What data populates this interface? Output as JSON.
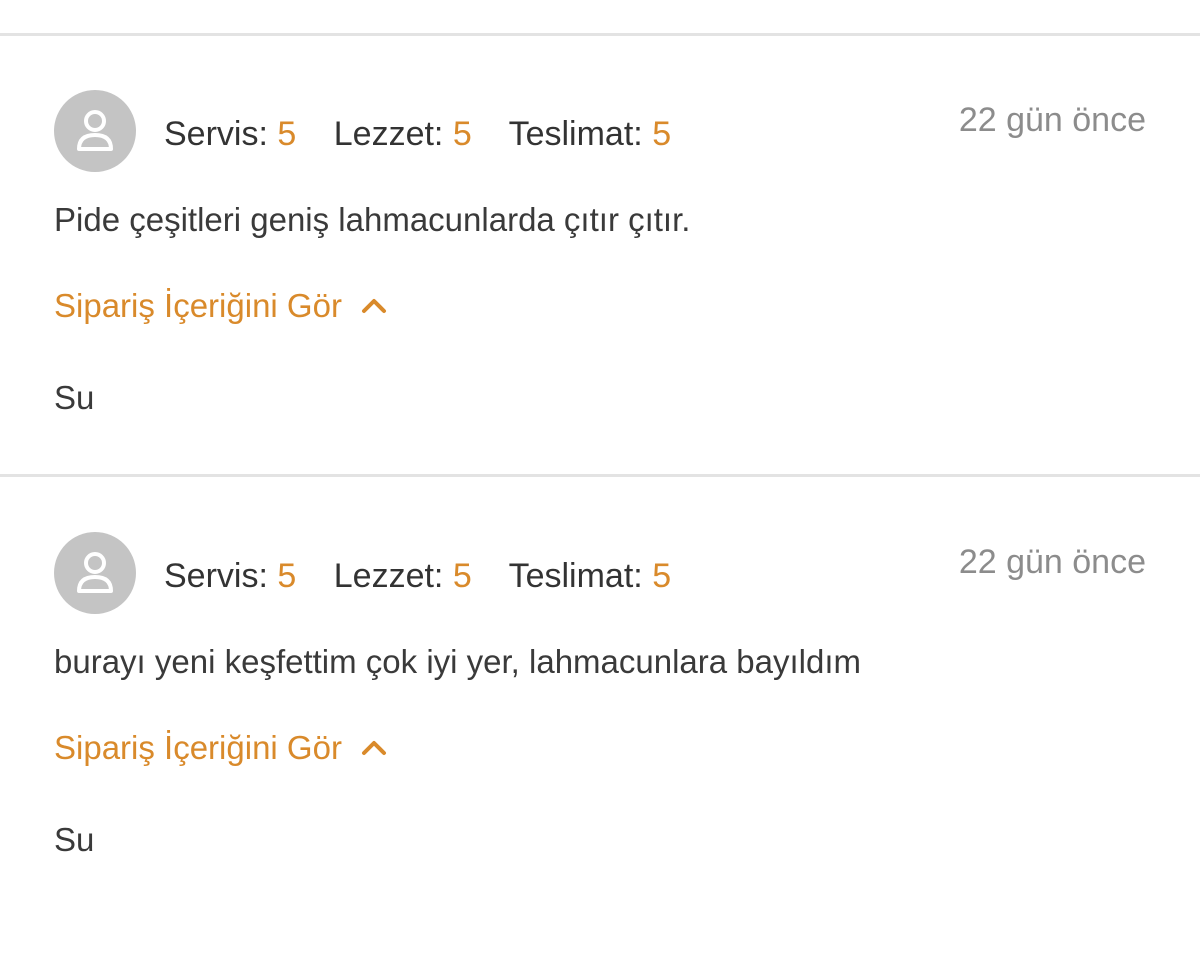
{
  "reviews": [
    {
      "ratings": [
        {
          "label": "Servis:",
          "value": "5"
        },
        {
          "label": "Lezzet:",
          "value": "5"
        },
        {
          "label": "Teslimat:",
          "value": "5"
        }
      ],
      "date": "22 gün önce",
      "comment": "Pide çeşitleri geniş lahmacunlarda çıtır çıtır.",
      "order_toggle_label": "Sipariş İçeriğini Gör",
      "order_content": "Su"
    },
    {
      "ratings": [
        {
          "label": "Servis:",
          "value": "5"
        },
        {
          "label": "Lezzet:",
          "value": "5"
        },
        {
          "label": "Teslimat:",
          "value": "5"
        }
      ],
      "date": "22 gün önce",
      "comment": "burayı yeni keşfettim çok iyi yer, lahmacunlara bayıldım",
      "order_toggle_label": "Sipariş İçeriğini Gör",
      "order_content": "Su"
    }
  ],
  "colors": {
    "accent": "#d98a2b",
    "avatar_bg": "#c4c4c4",
    "divider": "#e3e3e3",
    "date_text": "#8c8c8c"
  },
  "icons": {
    "avatar": "user-icon",
    "toggle": "chevron-up-icon"
  }
}
